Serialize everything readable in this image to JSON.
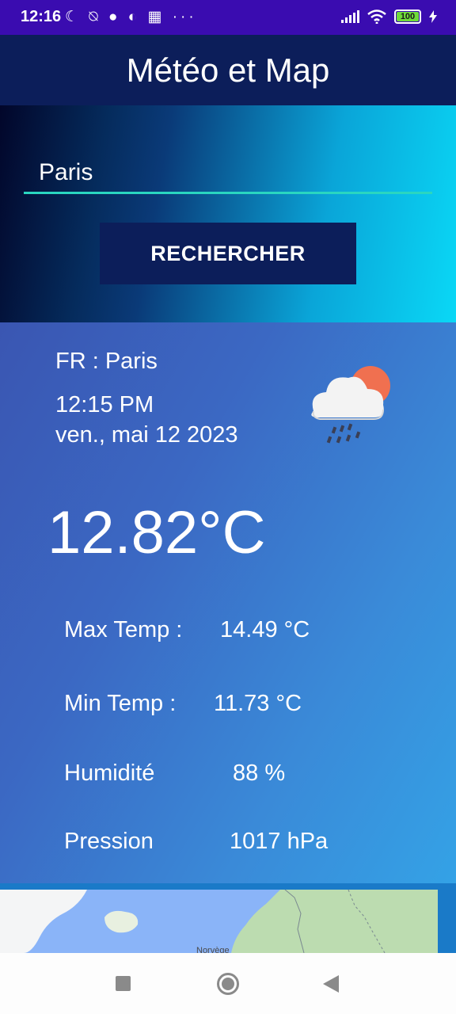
{
  "status_bar": {
    "time": "12:16",
    "left_icons": [
      "moon-icon",
      "bell-off-icon",
      "chat-icon",
      "app-icon",
      "grid-icon",
      "more-icon"
    ],
    "left_glyphs": "☾ ⍉ ● ◐ ▦ ···",
    "battery": "100"
  },
  "header": {
    "title": "Météo et Map"
  },
  "search": {
    "value": "Paris",
    "button_label": "RECHERCHER"
  },
  "weather": {
    "location": "FR  :  Paris",
    "time": "12:15 PM",
    "date": "ven., mai 12 2023",
    "icon": "cloud-sun-rain-icon",
    "temperature": "12.82°C",
    "stats": [
      {
        "label": "Max Temp :",
        "value": "14.49 °C"
      },
      {
        "label": "Min Temp :",
        "value": "11.73 °C"
      },
      {
        "label": "Humidité",
        "value": "88  %"
      },
      {
        "label": "Pression",
        "value": "1017  hPa"
      }
    ]
  },
  "map": {
    "label": "Norvège"
  },
  "colors": {
    "status_bar": "#3a0cb0",
    "header": "#0c1e5a",
    "input_underline": "#2ad6c0",
    "sun": "#f07050"
  }
}
